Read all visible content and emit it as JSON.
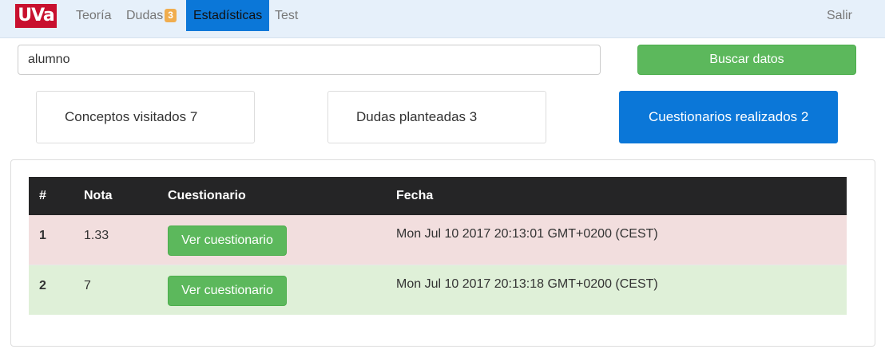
{
  "nav": {
    "logo": "UVa",
    "items": [
      {
        "label": "Teoría"
      },
      {
        "label": "Dudas",
        "badge": "3"
      },
      {
        "label": "Estadísticas"
      },
      {
        "label": "Test"
      }
    ],
    "logout": "Salir"
  },
  "search": {
    "value": "alumno",
    "button_label": "Buscar datos"
  },
  "stats": [
    {
      "label": "Conceptos visitados 7"
    },
    {
      "label": "Dudas planteadas 3"
    },
    {
      "label": "Cuestionarios realizados 2"
    }
  ],
  "table": {
    "headers": [
      "#",
      "Nota",
      "Cuestionario",
      "Fecha"
    ],
    "rows": [
      {
        "num": "1",
        "nota": "1.33",
        "button": "Ver cuestionario",
        "fecha": "Mon Jul 10 2017 20:13:01 GMT+0200 (CEST)"
      },
      {
        "num": "2",
        "nota": "7",
        "button": "Ver cuestionario",
        "fecha": "Mon Jul 10 2017 20:13:18 GMT+0200 (CEST)"
      }
    ]
  },
  "colors": {
    "brand": "#c8102e",
    "active_nav": "#0b77d8",
    "success_button": "#5cb85c",
    "badge": "#f0ad4e",
    "row_danger": "#f2dede",
    "row_success": "#dff0d8"
  }
}
